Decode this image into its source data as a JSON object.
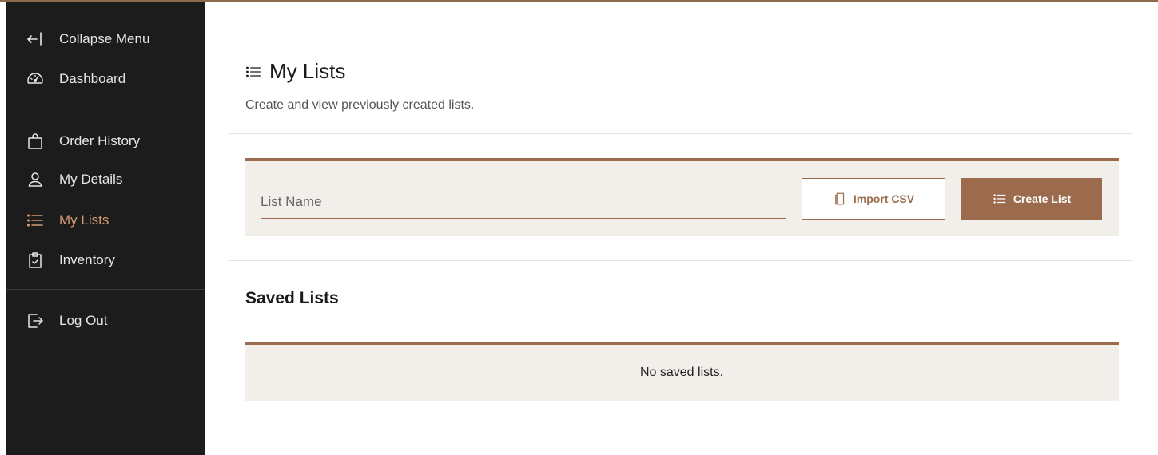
{
  "sidebar": {
    "collapse": {
      "label": "Collapse Menu",
      "icon": "arrow-left-bar-icon"
    },
    "items": [
      {
        "label": "Dashboard",
        "icon": "speedometer-icon",
        "active": false
      },
      {
        "label": "Order History",
        "icon": "shopping-bag-icon",
        "active": false
      },
      {
        "label": "My Details",
        "icon": "user-icon",
        "active": false
      },
      {
        "label": "My Lists",
        "icon": "list-icon",
        "active": true
      },
      {
        "label": "Inventory",
        "icon": "clipboard-check-icon",
        "active": false
      },
      {
        "label": "Log Out",
        "icon": "logout-icon",
        "active": false
      }
    ]
  },
  "main": {
    "title": "My Lists",
    "subtitle": "Create and view previously created lists.",
    "form": {
      "name_placeholder": "List Name",
      "import_label": "Import CSV",
      "create_label": "Create List"
    },
    "saved": {
      "title": "Saved Lists",
      "empty_text": "No saved lists."
    }
  },
  "colors": {
    "accent": "#9c6b4d",
    "active_text": "#d49a72",
    "sidebar_bg": "#1c1c1c",
    "panel_bg": "#f2eee9"
  }
}
